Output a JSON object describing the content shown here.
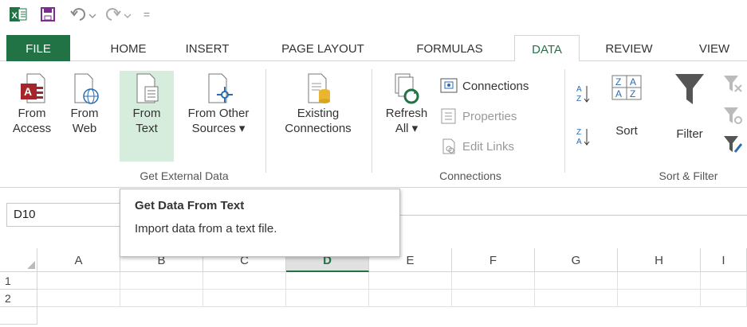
{
  "qat": {
    "excel_logo": "X",
    "customize_label": "="
  },
  "tabs": [
    "FILE",
    "HOME",
    "INSERT",
    "PAGE LAYOUT",
    "FORMULAS",
    "DATA",
    "REVIEW",
    "VIEW"
  ],
  "active_tab": "DATA",
  "ribbon": {
    "get_external_data": {
      "label": "Get External Data",
      "from_access": [
        "From",
        "Access"
      ],
      "from_web": [
        "From",
        "Web"
      ],
      "from_text": [
        "From",
        "Text"
      ],
      "from_other": [
        "From Other",
        "Sources ▾"
      ],
      "existing": [
        "Existing",
        "Connections"
      ]
    },
    "connections": {
      "label": "Connections",
      "refresh": [
        "Refresh",
        "All ▾"
      ],
      "connections_btn": "Connections",
      "properties_btn": "Properties",
      "edit_links_btn": "Edit Links"
    },
    "sort_filter": {
      "label": "Sort & Filter",
      "sort": "Sort",
      "filter": "Filter",
      "az": "A Z",
      "za": "Z A"
    }
  },
  "namebox": {
    "value": "D10"
  },
  "tooltip": {
    "title": "Get Data From Text",
    "description": "Import data from a text file."
  },
  "grid": {
    "columns": [
      "A",
      "B",
      "C",
      "D",
      "E",
      "F",
      "G",
      "H",
      "I"
    ],
    "selected_column": "D",
    "rows": [
      "1",
      "2"
    ]
  },
  "colors": {
    "accent": "#217346",
    "highlight": "#d6ecdc"
  }
}
